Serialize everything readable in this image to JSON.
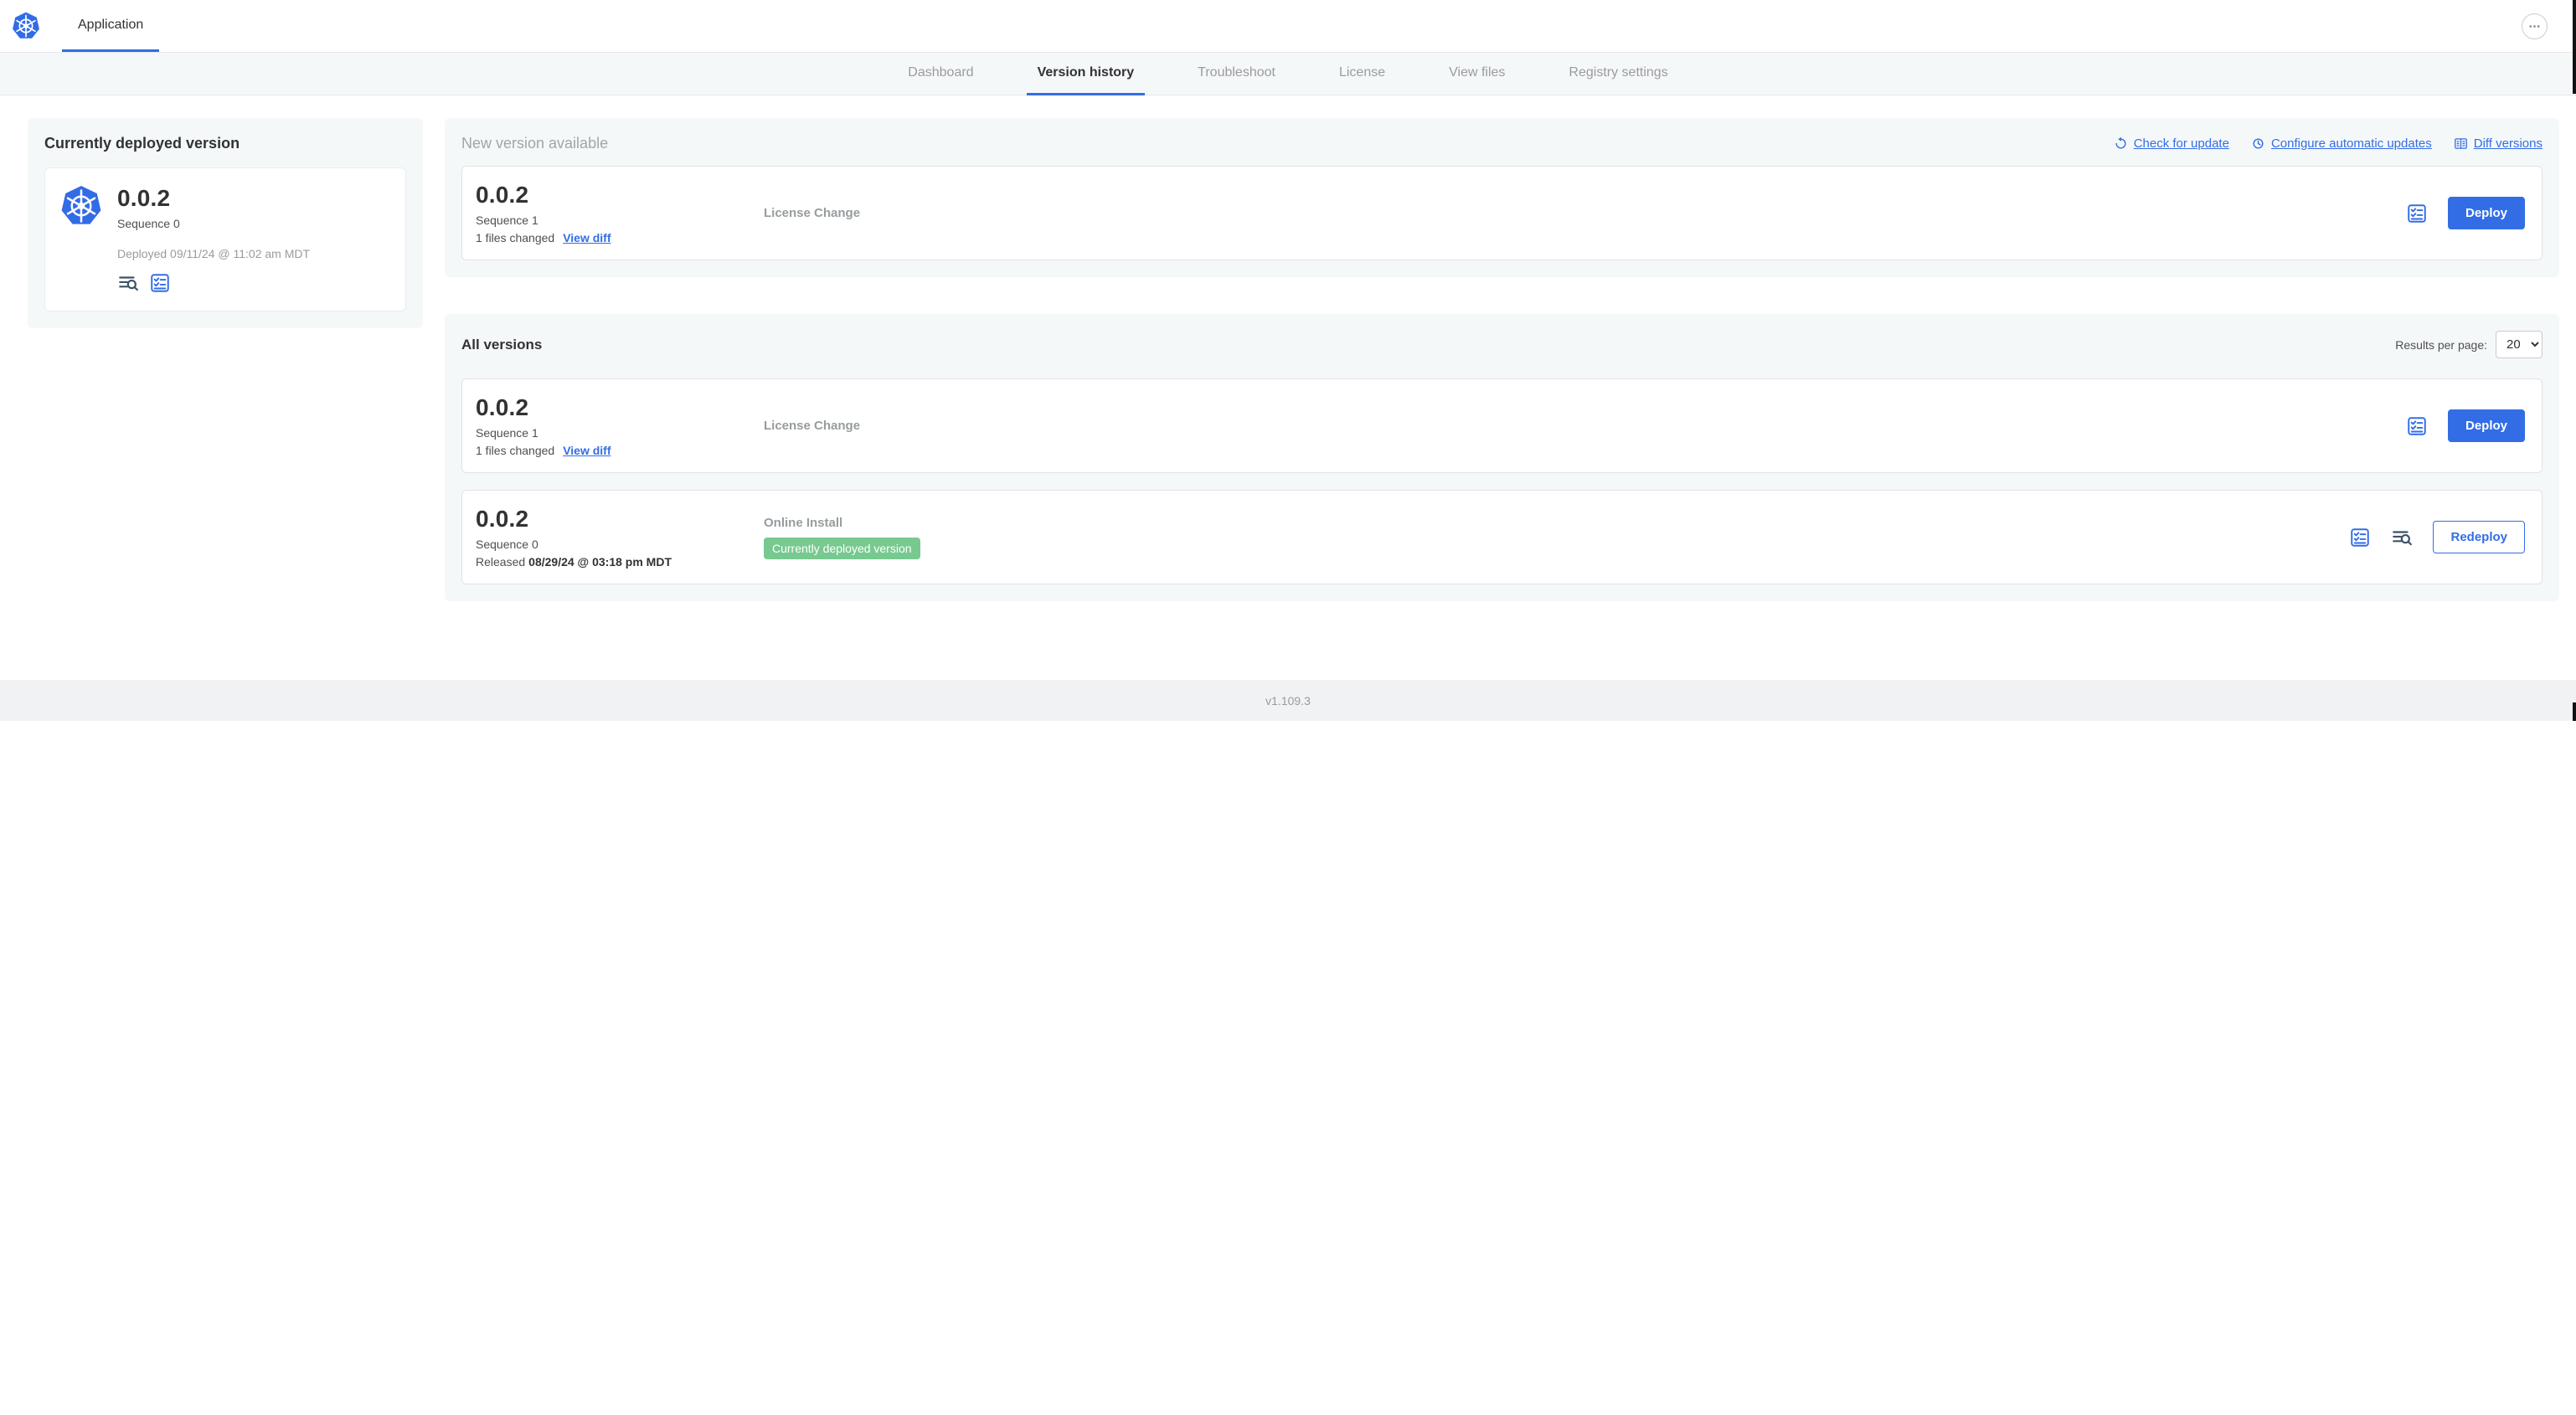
{
  "colors": {
    "accent": "#326de6",
    "badge_green": "#77c98f",
    "k8s_blue": "#326ce5"
  },
  "header": {
    "app_tab": "Application"
  },
  "nav": {
    "active_tab": "Version history",
    "tabs": [
      {
        "label": "Dashboard"
      },
      {
        "label": "Version history"
      },
      {
        "label": "Troubleshoot"
      },
      {
        "label": "License"
      },
      {
        "label": "View files"
      },
      {
        "label": "Registry settings"
      }
    ]
  },
  "current_version": {
    "section_title": "Currently deployed version",
    "version": "0.0.2",
    "sequence": "Sequence 0",
    "deployed": "Deployed 09/11/24 @ 11:02 am MDT"
  },
  "new_version": {
    "section_title": "New version available",
    "check_for_update": "Check for update",
    "configure_automatic_updates": "Configure automatic updates",
    "diff_versions": "Diff versions",
    "row": {
      "version": "0.0.2",
      "sequence": "Sequence 1",
      "files_changed": "1 files changed",
      "view_diff": "View diff",
      "source": "License Change",
      "action": "Deploy"
    }
  },
  "all_versions": {
    "section_title": "All versions",
    "results_per_page_label": "Results per page:",
    "results_per_page_value": "20",
    "rows": [
      {
        "version": "0.0.2",
        "sequence": "Sequence 1",
        "files_changed": "1 files changed",
        "view_diff": "View diff",
        "source": "License Change",
        "action": "Deploy"
      },
      {
        "version": "0.0.2",
        "sequence": "Sequence 0",
        "released_prefix": "Released",
        "released_date": "08/29/24 @ 03:18 pm MDT",
        "source": "Online Install",
        "badge": "Currently deployed version",
        "action": "Redeploy"
      }
    ]
  },
  "footer": {
    "app_version": "v1.109.3"
  },
  "icons": {
    "brand": "kubernetes-logo",
    "more_options": "ellipsis-icon",
    "check_for_update": "refresh-ccw-icon",
    "configure_automatic_updates": "clock-icon",
    "diff_versions": "diff-table-icon",
    "preflight_checks": "checklist-icon",
    "deploy_logs": "log-search-icon"
  }
}
